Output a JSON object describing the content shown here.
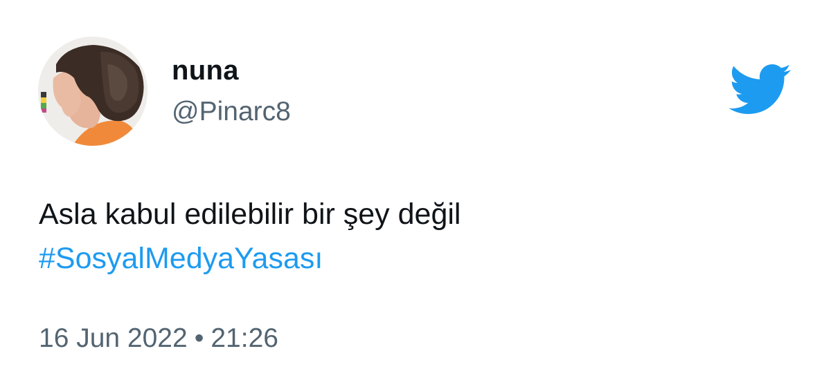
{
  "tweet": {
    "author": {
      "name": "nuna",
      "handle": "@Pinarc8"
    },
    "text": "Asla kabul edilebilir bir şey değil",
    "hashtag": "#SosyalMedyaYasası",
    "date": "16 Jun 2022",
    "separator": "•",
    "time": "21:26"
  },
  "icons": {
    "brand": "twitter-bird-icon"
  },
  "colors": {
    "brand_blue": "#1d9bf0",
    "text_primary": "#0f1419",
    "text_secondary": "#536471"
  }
}
